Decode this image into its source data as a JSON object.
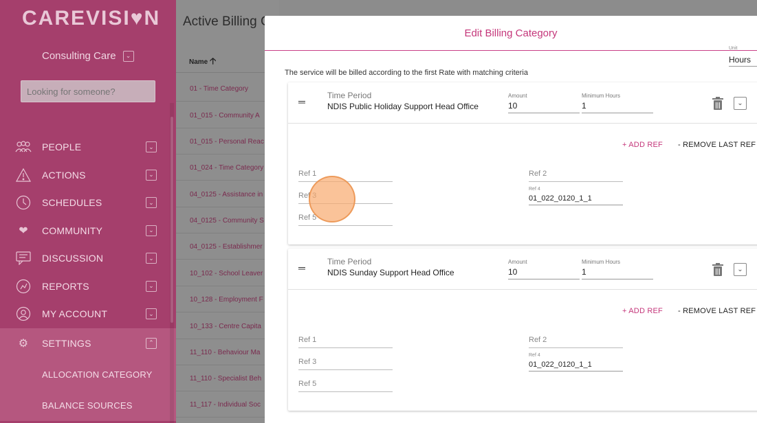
{
  "sidebar": {
    "logo": "CAREVISI♥N",
    "org_name": "Consulting Care",
    "search_placeholder": "Looking for someone?",
    "items": [
      {
        "label": "PEOPLE",
        "icon": "people-icon"
      },
      {
        "label": "ACTIONS",
        "icon": "warning-icon"
      },
      {
        "label": "SCHEDULES",
        "icon": "clock-icon"
      },
      {
        "label": "COMMUNITY",
        "icon": "hearts-icon"
      },
      {
        "label": "DISCUSSION",
        "icon": "chat-icon"
      },
      {
        "label": "REPORTS",
        "icon": "reports-icon"
      },
      {
        "label": "MY ACCOUNT",
        "icon": "user-icon"
      },
      {
        "label": "SETTINGS",
        "icon": "gear-icon"
      }
    ],
    "sub_items": [
      "ALLOCATION CATEGORY",
      "BALANCE SOURCES"
    ]
  },
  "background": {
    "title": "Active Billing C",
    "column_name": "Name",
    "rows": [
      "01 - Time Category",
      "01_015 - Community A",
      "01_015 - Personal Reac",
      "01_024 - Time Category",
      "04_0125 - Assistance in",
      "04_0125 - Community S",
      "04_0125 - Establishmer",
      "10_102 - School Leaver",
      "10_128 - Employment F",
      "10_133 - Centre Capita",
      "11_110 - Behaviour Ma",
      "11_110 - Specialist Beh",
      "11_117 - Individual Soc"
    ]
  },
  "modal": {
    "title": "Edit Billing Category",
    "unit_label": "Unit",
    "unit_value": "Hours",
    "notice": "The service will be billed according to the first Rate with matching criteria",
    "add_ref": "+ ADD REF",
    "remove_ref": "- REMOVE LAST REF",
    "rates": [
      {
        "time_period_label": "Time Period",
        "time_period": "NDIS Public Holiday Support Head Office",
        "amount_label": "Amount",
        "amount": "10",
        "min_hours_label": "Minimum Hours",
        "min_hours": "1",
        "ref1": "Ref 1",
        "ref2": "Ref 2",
        "ref3": "Ref 3",
        "ref4_label": "Ref 4",
        "ref4": "01_022_0120_1_1",
        "ref5": "Ref 5"
      },
      {
        "time_period_label": "Time Period",
        "time_period": "NDIS Sunday Support Head Office",
        "amount_label": "Amount",
        "amount": "10",
        "min_hours_label": "Minimum Hours",
        "min_hours": "1",
        "ref1": "Ref 1",
        "ref2": "Ref 2",
        "ref3": "Ref 3",
        "ref4_label": "Ref 4",
        "ref4": "01_022_0120_1_1",
        "ref5": "Ref 5"
      }
    ]
  },
  "colors": {
    "sidebar": "#a53f6c",
    "accent": "#c4367a",
    "overlay": "#8c8c8c"
  }
}
